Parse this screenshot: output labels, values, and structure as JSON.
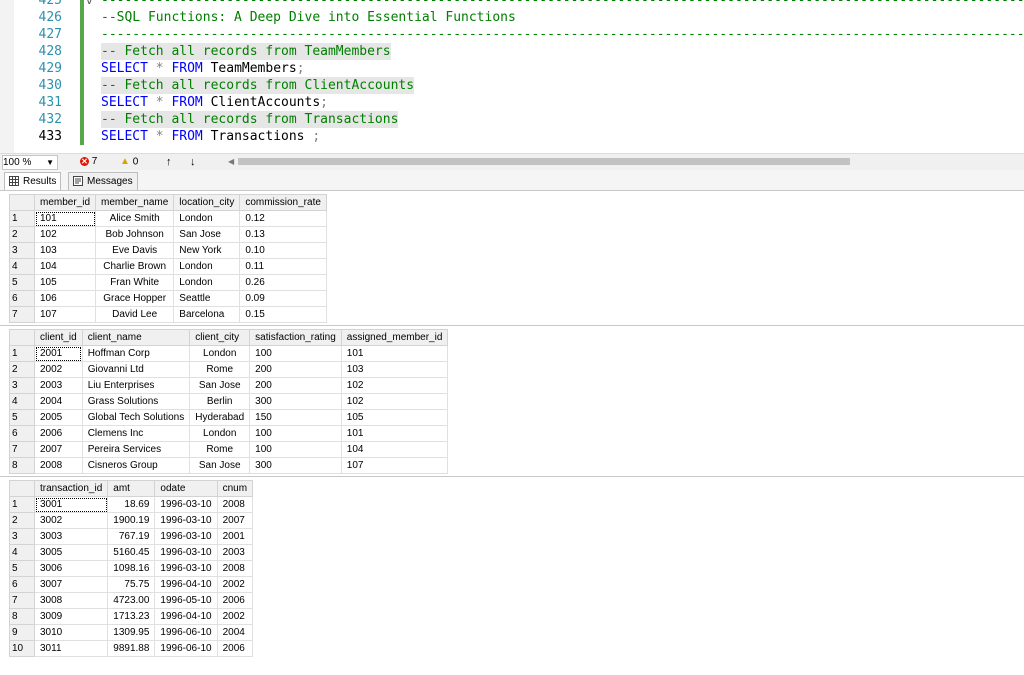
{
  "editor": {
    "lines": [
      {
        "num": "425",
        "text": "--------------------------------------------------------------------------------------------------------------------------",
        "kind": "cmt",
        "fold": "v"
      },
      {
        "num": "426",
        "text": "--SQL Functions: A Deep Dive into Essential Functions",
        "kind": "cmt"
      },
      {
        "num": "427",
        "text": "--------------------------------------------------------------------------------------------------------------------------",
        "kind": "cmt"
      },
      {
        "num": "428",
        "text": "-- Fetch all records from TeamMembers",
        "kind": "cmt_sel"
      },
      {
        "num": "429",
        "kw1": "SELECT",
        "op": "*",
        "kw2": "FROM",
        "table": "TeamMembers",
        "end": ";",
        "kind": "sql"
      },
      {
        "num": "430",
        "text": "-- Fetch all records from ClientAccounts",
        "kind": "cmt_sel"
      },
      {
        "num": "431",
        "kw1": "SELECT",
        "op": "*",
        "kw2": "FROM",
        "table": "ClientAccounts",
        "end": ";",
        "kind": "sql"
      },
      {
        "num": "432",
        "text": "-- Fetch all records from Transactions",
        "kind": "cmt_sel"
      },
      {
        "num": "433",
        "kw1": "SELECT",
        "op": "*",
        "kw2": "FROM",
        "table": "Transactions",
        "end": " ;",
        "kind": "sql",
        "current": true
      }
    ]
  },
  "status": {
    "zoom": "100 %",
    "errors": "7",
    "warnings": "0"
  },
  "tabs": {
    "results": "Results",
    "messages": "Messages"
  },
  "grids": [
    {
      "columns": [
        "member_id",
        "member_name",
        "location_city",
        "commission_rate"
      ],
      "aligns": [
        "left",
        "center",
        "left",
        "left"
      ],
      "rows": [
        [
          "1",
          "101",
          "Alice Smith",
          "London",
          "0.12"
        ],
        [
          "2",
          "102",
          "Bob Johnson",
          "San Jose",
          "0.13"
        ],
        [
          "3",
          "103",
          "Eve Davis",
          "New York",
          "0.10"
        ],
        [
          "4",
          "104",
          "Charlie Brown",
          "London",
          "0.11"
        ],
        [
          "5",
          "105",
          "Fran White",
          "London",
          "0.26"
        ],
        [
          "6",
          "106",
          "Grace Hopper",
          "Seattle",
          "0.09"
        ],
        [
          "7",
          "107",
          "David Lee",
          "Barcelona",
          "0.15"
        ]
      ]
    },
    {
      "columns": [
        "client_id",
        "client_name",
        "client_city",
        "satisfaction_rating",
        "assigned_member_id"
      ],
      "aligns": [
        "left",
        "left",
        "center",
        "left",
        "left"
      ],
      "rows": [
        [
          "1",
          "2001",
          "Hoffman Corp",
          "London",
          "100",
          "101"
        ],
        [
          "2",
          "2002",
          "Giovanni Ltd",
          "Rome",
          "200",
          "103"
        ],
        [
          "3",
          "2003",
          "Liu Enterprises",
          "San Jose",
          "200",
          "102"
        ],
        [
          "4",
          "2004",
          "Grass Solutions",
          "Berlin",
          "300",
          "102"
        ],
        [
          "5",
          "2005",
          "Global Tech Solutions",
          "Hyderabad",
          "150",
          "105"
        ],
        [
          "6",
          "2006",
          "Clemens Inc",
          "London",
          "100",
          "101"
        ],
        [
          "7",
          "2007",
          "Pereira Services",
          "Rome",
          "100",
          "104"
        ],
        [
          "8",
          "2008",
          "Cisneros Group",
          "San Jose",
          "300",
          "107"
        ]
      ]
    },
    {
      "columns": [
        "transaction_id",
        "amt",
        "odate",
        "cnum"
      ],
      "aligns": [
        "left",
        "right",
        "left",
        "left"
      ],
      "rows": [
        [
          "1",
          "3001",
          "18.69",
          "1996-03-10",
          "2008"
        ],
        [
          "2",
          "3002",
          "1900.19",
          "1996-03-10",
          "2007"
        ],
        [
          "3",
          "3003",
          "767.19",
          "1996-03-10",
          "2001"
        ],
        [
          "4",
          "3005",
          "5160.45",
          "1996-03-10",
          "2003"
        ],
        [
          "5",
          "3006",
          "1098.16",
          "1996-03-10",
          "2008"
        ],
        [
          "6",
          "3007",
          "75.75",
          "1996-04-10",
          "2002"
        ],
        [
          "7",
          "3008",
          "4723.00",
          "1996-05-10",
          "2006"
        ],
        [
          "8",
          "3009",
          "1713.23",
          "1996-04-10",
          "2002"
        ],
        [
          "9",
          "3010",
          "1309.95",
          "1996-06-10",
          "2004"
        ],
        [
          "10",
          "3011",
          "9891.88",
          "1996-06-10",
          "2006"
        ]
      ]
    }
  ]
}
